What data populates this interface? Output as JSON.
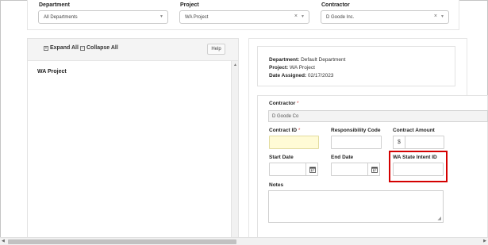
{
  "filters": {
    "department": {
      "label": "Department",
      "value": "All Departments"
    },
    "project": {
      "label": "Project",
      "value": "WA Project",
      "clear": "×"
    },
    "contractor": {
      "label": "Contractor",
      "value": "D Goode Inc.",
      "clear": "×"
    }
  },
  "tree": {
    "expand_all": "Expand All",
    "collapse_all": "Collapse All",
    "expand_glyph": "+",
    "collapse_glyph": "−",
    "help": "Help",
    "node": "WA Project"
  },
  "info": {
    "department_label": "Department:",
    "department_value": "Default Department",
    "project_label": "Project:",
    "project_value": "WA Project",
    "date_label": "Date Assigned:",
    "date_value": "02/17/2023"
  },
  "form": {
    "contractor_label": "Contractor",
    "contractor_value": "D Goode Co",
    "required_mark": "*",
    "contract_id_label": "Contract ID",
    "responsibility_code_label": "Responsibility Code",
    "contract_amount_label": "Contract Amount",
    "currency_symbol": "$",
    "start_date_label": "Start Date",
    "end_date_label": "End Date",
    "wa_state_intent_label": "WA State Intent ID",
    "notes_label": "Notes"
  },
  "colors": {
    "highlight": "#d40000",
    "required": "#d9534f",
    "contract_id_bg": "#fffbd6"
  }
}
